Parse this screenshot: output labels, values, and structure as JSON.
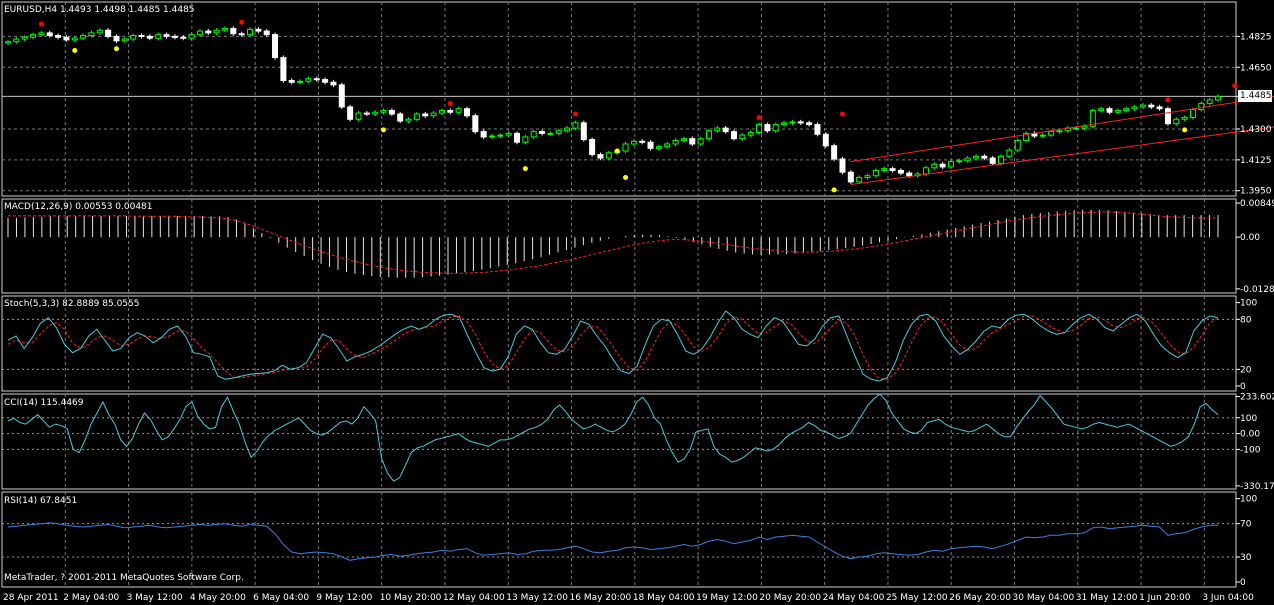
{
  "headers": {
    "main": "EURUSD,H4  1.4493 1.4498 1.4485 1.4485",
    "macd": "MACD(12,26,9) 0.00553 0.00481",
    "stoch": "Stoch(5,3,3) 82.8889 85.0555",
    "cci": "CCI(14) 115.4469",
    "rsi": "RSI(14) 67.8451"
  },
  "current_price": "1.4485",
  "copyright": "MetaTrader, ? 2001-2011 MetaQuotes Software Corp.",
  "colors": {
    "bull": "#00ff00",
    "bear": "#ffffff",
    "grid": "#7a7a7a",
    "macd_signal": "#ff2020",
    "stoch_main": "#4fc8d8",
    "stoch_signal": "#ff2020",
    "cci": "#4fc8d8",
    "rsi": "#3d7fe0",
    "channel": "#ff2020",
    "fractal_up": "#ff0000",
    "fractal_down": "#ffff00"
  },
  "chart_data": [
    {
      "type": "candlestick",
      "symbol": "EURUSD",
      "timeframe": "H4",
      "y_ticks": [
        "1.4825",
        "1.4650",
        "1.4485",
        "1.4300",
        "1.4125",
        "1.3950"
      ],
      "ylim": [
        1.392,
        1.502
      ],
      "x_ticks": [
        "28 Apr 2011",
        "2 May 04:00",
        "3 May 12:00",
        "4 May 20:00",
        "6 May 04:00",
        "9 May 12:00",
        "10 May 20:00",
        "12 May 04:00",
        "13 May 12:00",
        "16 May 20:00",
        "18 May 04:00",
        "19 May 12:00",
        "20 May 20:00",
        "24 May 04:00",
        "25 May 12:00",
        "26 May 20:00",
        "30 May 04:00",
        "31 May 12:00",
        "1 Jun 20:00",
        "3 Jun 04:00"
      ],
      "close": [
        1.4795,
        1.481,
        1.482,
        1.4835,
        1.4845,
        1.483,
        1.482,
        1.4805,
        1.4815,
        1.483,
        1.4845,
        1.486,
        1.4825,
        1.48,
        1.481,
        1.483,
        1.4825,
        1.4815,
        1.4835,
        1.4825,
        1.482,
        1.4815,
        1.4835,
        1.4855,
        1.4845,
        1.486,
        1.487,
        1.484,
        1.4835,
        1.4865,
        1.4855,
        1.4835,
        1.4705,
        1.4575,
        1.4565,
        1.457,
        1.4585,
        1.458,
        1.4565,
        1.455,
        1.4425,
        1.4355,
        1.439,
        1.4385,
        1.4395,
        1.4405,
        1.4385,
        1.4345,
        1.4355,
        1.4385,
        1.4375,
        1.439,
        1.4405,
        1.4395,
        1.4415,
        1.4375,
        1.4285,
        1.4255,
        1.426,
        1.4265,
        1.4275,
        1.4225,
        1.4255,
        1.4285,
        1.4275,
        1.4275,
        1.429,
        1.4305,
        1.4335,
        1.424,
        1.4155,
        1.4135,
        1.4165,
        1.4175,
        1.4215,
        1.423,
        1.4225,
        1.419,
        1.42,
        1.4215,
        1.4235,
        1.4245,
        1.4215,
        1.4245,
        1.429,
        1.4305,
        1.4285,
        1.4245,
        1.4265,
        1.428,
        1.4325,
        1.429,
        1.4325,
        1.4335,
        1.434,
        1.4335,
        1.4325,
        1.427,
        1.4205,
        1.413,
        1.4055,
        1.4,
        1.4025,
        1.4035,
        1.4065,
        1.4075,
        1.4065,
        1.405,
        1.4035,
        1.4045,
        1.408,
        1.41,
        1.4085,
        1.4115,
        1.412,
        1.4135,
        1.4145,
        1.4135,
        1.4105,
        1.4145,
        1.418,
        1.4235,
        1.4275,
        1.426,
        1.4265,
        1.4285,
        1.429,
        1.4305,
        1.4305,
        1.4315,
        1.4405,
        1.4415,
        1.4395,
        1.4405,
        1.4415,
        1.4425,
        1.4435,
        1.4425,
        1.4415,
        1.433,
        1.4355,
        1.4365,
        1.441,
        1.4445,
        1.4465,
        1.4485
      ],
      "fractals_up": [
        [
          4,
          1.4895
        ],
        [
          28,
          1.4905
        ],
        [
          53,
          1.4445
        ],
        [
          68,
          1.4385
        ],
        [
          90,
          1.4365
        ],
        [
          100,
          1.4385
        ],
        [
          139,
          1.4465
        ],
        [
          147,
          1.4545
        ]
      ],
      "fractals_down": [
        [
          8,
          1.4745
        ],
        [
          13,
          1.4755
        ],
        [
          45,
          1.4295
        ],
        [
          62,
          1.4075
        ],
        [
          73,
          1.4175
        ],
        [
          74,
          1.4025
        ],
        [
          99,
          1.3955
        ],
        [
          141,
          1.4295
        ]
      ],
      "channel_lines": [
        [
          [
            101,
            1.4115
          ],
          [
            160,
            1.4545
          ]
        ],
        [
          [
            101,
            1.3985
          ],
          [
            160,
            1.4365
          ]
        ]
      ]
    },
    {
      "type": "bar",
      "name": "MACD(12,26,9)",
      "y_ticks": [
        "0.00849",
        "0.00",
        "-0.01287"
      ],
      "ylim": [
        -0.0139,
        0.0095
      ],
      "histogram": [
        0.0048,
        0.0048,
        0.0049,
        0.005,
        0.0051,
        0.0052,
        0.0052,
        0.0053,
        0.0053,
        0.0053,
        0.0053,
        0.0053,
        0.0053,
        0.0053,
        0.0053,
        0.0053,
        0.0053,
        0.0053,
        0.0053,
        0.0053,
        0.0053,
        0.0053,
        0.0053,
        0.0053,
        0.0052,
        0.0052,
        0.005,
        0.0044,
        0.0034,
        0.0022,
        0.001,
        -0.0002,
        -0.0014,
        -0.0026,
        -0.0037,
        -0.0047,
        -0.0057,
        -0.0066,
        -0.0074,
        -0.0081,
        -0.0087,
        -0.0091,
        -0.0094,
        -0.0097,
        -0.0099,
        -0.01,
        -0.0101,
        -0.0101,
        -0.0101,
        -0.01,
        -0.0098,
        -0.0096,
        -0.0093,
        -0.009,
        -0.0087,
        -0.0084,
        -0.0081,
        -0.0077,
        -0.0073,
        -0.0069,
        -0.0065,
        -0.006,
        -0.0055,
        -0.005,
        -0.0044,
        -0.0038,
        -0.0032,
        -0.0026,
        -0.002,
        -0.0014,
        -0.0009,
        -0.0004,
        0.0,
        0.0003,
        0.0005,
        0.0006,
        0.0006,
        0.0005,
        0.0002,
        -0.0002,
        -0.0007,
        -0.0012,
        -0.0018,
        -0.0024,
        -0.0029,
        -0.0034,
        -0.0038,
        -0.0041,
        -0.0043,
        -0.0044,
        -0.0044,
        -0.0043,
        -0.0042,
        -0.0041,
        -0.0039,
        -0.0037,
        -0.0035,
        -0.0032,
        -0.003,
        -0.0027,
        -0.0024,
        -0.0021,
        -0.0017,
        -0.0013,
        -0.0009,
        -0.0005,
        -0.0001,
        0.0003,
        0.0007,
        0.0011,
        0.0015,
        0.0019,
        0.0023,
        0.0027,
        0.0031,
        0.0035,
        0.0039,
        0.0043,
        0.0047,
        0.0051,
        0.0055,
        0.0058,
        0.006,
        0.0062,
        0.0064,
        0.0066,
        0.0067,
        0.0068,
        0.0068,
        0.0068,
        0.0067,
        0.0065,
        0.0063,
        0.0061,
        0.0059,
        0.0057,
        0.0055,
        0.0055,
        0.0055,
        0.0055,
        0.0055,
        0.0055,
        0.0055,
        0.0055
      ],
      "signal": [
        0.0053,
        0.0053,
        0.0053,
        0.0053,
        0.0053,
        0.0053,
        0.0053,
        0.0053,
        0.0053,
        0.0053,
        0.0053,
        0.0053,
        0.0053,
        0.0053,
        0.0053,
        0.0052,
        0.0052,
        0.0052,
        0.0052,
        0.0052,
        0.0052,
        0.0051,
        0.0051,
        0.005,
        0.0049,
        0.0048,
        0.0046,
        0.0042,
        0.0036,
        0.0029,
        0.0021,
        0.0013,
        0.0005,
        -0.0003,
        -0.0011,
        -0.0019,
        -0.0027,
        -0.0034,
        -0.0041,
        -0.0047,
        -0.0053,
        -0.0059,
        -0.0064,
        -0.0069,
        -0.0073,
        -0.0077,
        -0.008,
        -0.0083,
        -0.0085,
        -0.0087,
        -0.0088,
        -0.0089,
        -0.009,
        -0.009,
        -0.009,
        -0.0089,
        -0.0088,
        -0.0087,
        -0.0085,
        -0.0083,
        -0.0081,
        -0.0078,
        -0.0075,
        -0.0072,
        -0.0068,
        -0.0064,
        -0.006,
        -0.0056,
        -0.0051,
        -0.0046,
        -0.0041,
        -0.0036,
        -0.0031,
        -0.0026,
        -0.0021,
        -0.0017,
        -0.0013,
        -0.001,
        -0.0008,
        -0.0006,
        -0.0006,
        -0.0007,
        -0.0009,
        -0.0011,
        -0.0014,
        -0.0017,
        -0.002,
        -0.0023,
        -0.0026,
        -0.0029,
        -0.0031,
        -0.0033,
        -0.0035,
        -0.0036,
        -0.0037,
        -0.0037,
        -0.0037,
        -0.0036,
        -0.0035,
        -0.0033,
        -0.0031,
        -0.0029,
        -0.0026,
        -0.0023,
        -0.002,
        -0.0016,
        -0.0012,
        -0.0008,
        -0.0004,
        0.0,
        0.0004,
        0.0008,
        0.0012,
        0.0016,
        0.002,
        0.0024,
        0.0028,
        0.0032,
        0.0036,
        0.004,
        0.0043,
        0.0046,
        0.0049,
        0.0052,
        0.0054,
        0.0056,
        0.0058,
        0.006,
        0.0061,
        0.0062,
        0.0063,
        0.0063,
        0.0062,
        0.0061,
        0.0059,
        0.0057,
        0.0055,
        0.0053,
        0.0051,
        0.005,
        0.0049,
        0.0048,
        0.0048,
        0.0048,
        0.0048
      ]
    },
    {
      "type": "line",
      "name": "Stoch(5,3,3)",
      "y_ticks": [
        "100",
        "80",
        "20",
        "0"
      ],
      "ylim": [
        0,
        100
      ],
      "main": [
        55,
        60,
        45,
        58,
        75,
        82,
        70,
        50,
        40,
        45,
        60,
        68,
        55,
        42,
        45,
        58,
        64,
        60,
        52,
        58,
        68,
        72,
        60,
        40,
        38,
        35,
        12,
        8,
        10,
        12,
        14,
        15,
        16,
        18,
        25,
        20,
        22,
        28,
        45,
        62,
        58,
        45,
        30,
        35,
        38,
        42,
        48,
        55,
        62,
        68,
        72,
        68,
        72,
        80,
        85,
        86,
        82,
        60,
        40,
        22,
        18,
        20,
        35,
        62,
        72,
        68,
        52,
        40,
        38,
        44,
        60,
        78,
        74,
        60,
        48,
        32,
        18,
        15,
        24,
        50,
        72,
        80,
        78,
        62,
        42,
        38,
        44,
        58,
        76,
        90,
        82,
        68,
        62,
        58,
        72,
        82,
        78,
        64,
        50,
        48,
        56,
        72,
        82,
        84,
        60,
        36,
        14,
        8,
        6,
        10,
        28,
        55,
        74,
        84,
        86,
        78,
        60,
        48,
        38,
        44,
        54,
        66,
        72,
        70,
        80,
        85,
        86,
        80,
        72,
        66,
        62,
        64,
        74,
        82,
        86,
        80,
        70,
        66,
        74,
        82,
        86,
        78,
        62,
        48,
        40,
        34,
        40,
        66,
        78,
        84,
        82
      ],
      "signal": [
        50,
        55,
        52,
        52,
        62,
        72,
        76,
        68,
        52,
        45,
        50,
        58,
        60,
        55,
        48,
        50,
        56,
        60,
        59,
        57,
        60,
        66,
        66,
        57,
        46,
        38,
        28,
        18,
        10,
        10,
        12,
        13,
        15,
        16,
        19,
        21,
        22,
        23,
        32,
        45,
        55,
        55,
        44,
        37,
        34,
        38,
        43,
        48,
        55,
        62,
        67,
        69,
        70,
        73,
        79,
        83,
        84,
        76,
        61,
        41,
        27,
        20,
        24,
        40,
        56,
        67,
        64,
        53,
        43,
        41,
        47,
        61,
        71,
        71,
        61,
        47,
        33,
        22,
        19,
        30,
        49,
        67,
        77,
        73,
        61,
        47,
        41,
        47,
        59,
        75,
        83,
        80,
        71,
        63,
        64,
        71,
        77,
        75,
        64,
        54,
        51,
        59,
        70,
        79,
        75,
        60,
        37,
        19,
        9,
        8,
        15,
        31,
        52,
        71,
        81,
        83,
        75,
        62,
        49,
        43,
        45,
        55,
        64,
        69,
        74,
        78,
        84,
        84,
        79,
        73,
        67,
        64,
        67,
        73,
        81,
        83,
        79,
        72,
        70,
        74,
        81,
        82,
        75,
        63,
        50,
        41,
        38,
        47,
        61,
        76,
        81
      ]
    },
    {
      "type": "line",
      "name": "CCI(14)",
      "y_ticks": [
        "233.602",
        "100",
        "0.00",
        "-100",
        "-330.176"
      ],
      "ylim": [
        -350,
        250
      ],
      "values": [
        80,
        95,
        70,
        60,
        90,
        120,
        80,
        40,
        60,
        50,
        30,
        -100,
        -120,
        -40,
        60,
        130,
        200,
        120,
        60,
        -40,
        -80,
        -30,
        60,
        130,
        90,
        20,
        -40,
        -20,
        30,
        90,
        170,
        200,
        110,
        60,
        30,
        40,
        170,
        230,
        140,
        60,
        -60,
        -150,
        -110,
        -50,
        -10,
        20,
        40,
        60,
        80,
        100,
        60,
        20,
        0,
        -10,
        10,
        40,
        70,
        80,
        60,
        100,
        170,
        130,
        80,
        -160,
        -250,
        -300,
        -280,
        -200,
        -120,
        -90,
        -80,
        -60,
        -40,
        -30,
        -20,
        -10,
        0,
        -30,
        -50,
        -60,
        -70,
        -80,
        -60,
        -40,
        -40,
        -30,
        -10,
        10,
        30,
        40,
        60,
        90,
        150,
        180,
        140,
        90,
        60,
        30,
        40,
        60,
        40,
        20,
        10,
        30,
        60,
        120,
        200,
        230,
        180,
        100,
        60,
        -40,
        -120,
        -180,
        -160,
        -100,
        10,
        20,
        30,
        -80,
        -130,
        -150,
        -180,
        -170,
        -150,
        -120,
        -90,
        -100,
        -110,
        -100,
        -70,
        -30,
        0,
        20,
        40,
        70,
        50,
        20,
        10,
        -10,
        -30,
        -20,
        0,
        60,
        120,
        180,
        220,
        250,
        210,
        130,
        80,
        30,
        10,
        0,
        20,
        70,
        80,
        90,
        60,
        40,
        30,
        20,
        10,
        20,
        40,
        60,
        30,
        0,
        -20,
        -20,
        40,
        90,
        140,
        180,
        240,
        200,
        160,
        110,
        60,
        50,
        40,
        30,
        40,
        60,
        70,
        60,
        50,
        40,
        50,
        60,
        40,
        20,
        0,
        -20,
        -40,
        -60,
        -80,
        -70,
        -50,
        -20,
        60,
        170,
        190,
        150,
        120
      ],
      "levels": [
        100,
        0,
        -100
      ]
    },
    {
      "type": "line",
      "name": "RSI(14)",
      "y_ticks": [
        "100",
        "70",
        "30",
        "0"
      ],
      "ylim": [
        0,
        100
      ],
      "values": [
        66,
        67,
        68,
        69,
        70,
        71,
        70,
        68,
        67,
        66,
        67,
        68,
        69,
        67,
        65,
        66,
        67,
        68,
        66,
        65,
        66,
        67,
        68,
        69,
        68,
        69,
        70,
        68,
        67,
        69,
        68,
        67,
        58,
        45,
        36,
        34,
        35,
        36,
        35,
        34,
        30,
        26,
        28,
        29,
        30,
        32,
        33,
        31,
        32,
        34,
        35,
        36,
        38,
        37,
        39,
        40,
        35,
        32,
        33,
        34,
        35,
        33,
        34,
        37,
        38,
        38,
        39,
        41,
        43,
        40,
        36,
        35,
        37,
        38,
        41,
        42,
        41,
        39,
        40,
        41,
        43,
        45,
        43,
        45,
        49,
        51,
        49,
        46,
        48,
        50,
        54,
        51,
        54,
        55,
        56,
        55,
        54,
        48,
        42,
        36,
        31,
        28,
        30,
        31,
        34,
        35,
        34,
        33,
        32,
        33,
        36,
        38,
        37,
        40,
        41,
        42,
        43,
        42,
        40,
        43,
        46,
        50,
        54,
        53,
        54,
        56,
        56,
        58,
        58,
        59,
        65,
        66,
        64,
        65,
        66,
        67,
        68,
        67,
        66,
        56,
        58,
        59,
        63,
        66,
        68,
        68
      ]
    }
  ]
}
